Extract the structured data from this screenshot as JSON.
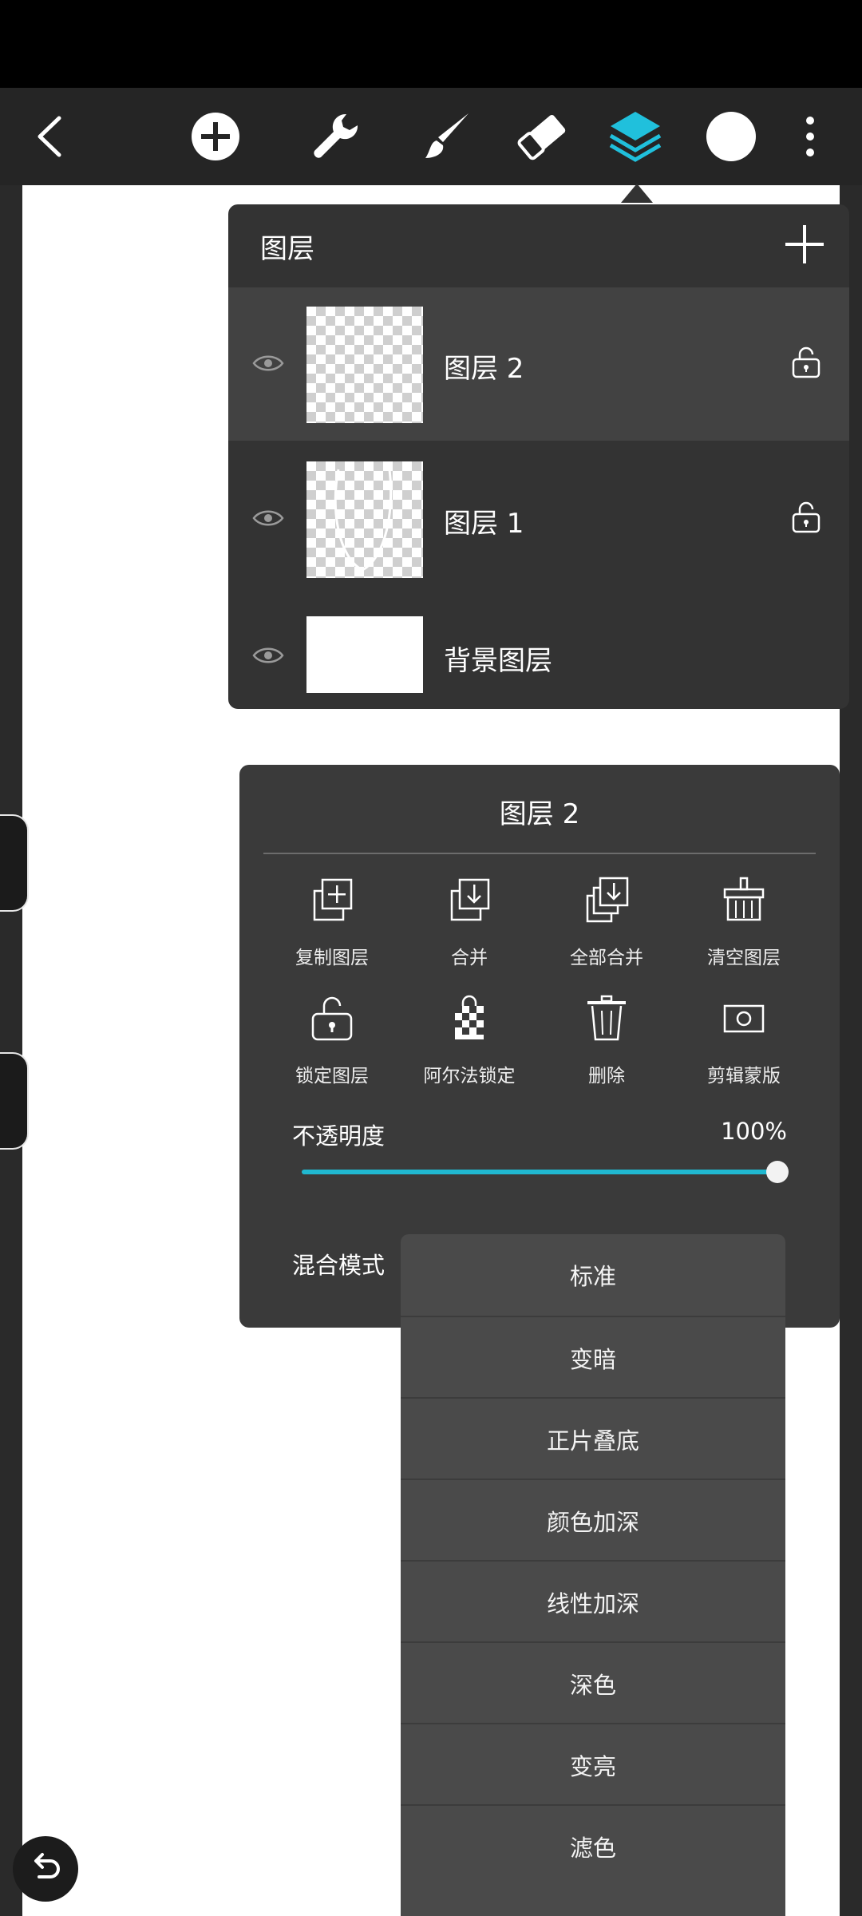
{
  "toolbar": {
    "icons": [
      "back-icon",
      "add-icon",
      "wrench-icon",
      "brush-icon",
      "eraser-icon",
      "layers-icon",
      "color-swatch",
      "more-icon"
    ],
    "accent": "#20c0dc",
    "current_color": "#ffffff"
  },
  "layers_panel": {
    "title": "图层",
    "layers": [
      {
        "name": "图层 2",
        "selected": true
      },
      {
        "name": "图层 1",
        "selected": false
      },
      {
        "name": "背景图层",
        "selected": false
      }
    ]
  },
  "layer_props": {
    "title": "图层 2",
    "actions": [
      {
        "label": "复制图层",
        "icon": "duplicate-layer-icon"
      },
      {
        "label": "合并",
        "icon": "merge-icon"
      },
      {
        "label": "全部合并",
        "icon": "merge-all-icon"
      },
      {
        "label": "清空图层",
        "icon": "clear-layer-icon"
      },
      {
        "label": "锁定图层",
        "icon": "lock-layer-icon"
      },
      {
        "label": "阿尔法锁定",
        "icon": "alpha-lock-icon"
      },
      {
        "label": "删除",
        "icon": "trash-icon"
      },
      {
        "label": "剪辑蒙版",
        "icon": "clipping-mask-icon"
      }
    ],
    "opacity_label": "不透明度",
    "opacity_value": "100%",
    "opacity_fraction": 1.0,
    "blend_label": "混合模式"
  },
  "blend_modes": [
    "标准",
    "变暗",
    "正片叠底",
    "颜色加深",
    "线性加深",
    "深色",
    "变亮",
    "滤色"
  ]
}
